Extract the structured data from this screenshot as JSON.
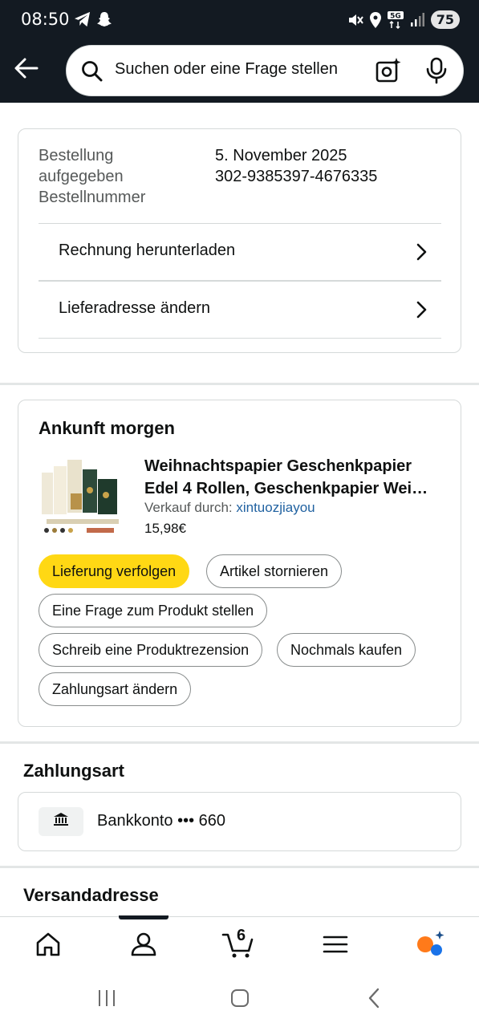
{
  "status": {
    "time": "08:50",
    "battery": "75"
  },
  "search": {
    "placeholder": "Suchen oder eine Frage stellen"
  },
  "order": {
    "label_placed": "Bestellung aufgegeben",
    "label_number": "Bestellnummer",
    "date": "5. November 2025",
    "number": "302-9385397-4676335",
    "invoice_link": "Rechnung herunterladen",
    "address_link": "Lieferadresse ändern"
  },
  "shipment": {
    "heading": "Ankunft morgen",
    "product_title": "Weihnachtspapier Geschenkpapier Edel 4 Rollen, Geschenkpapier Wei…",
    "seller_prefix": "Verkauf durch: ",
    "seller_name": "xintuozjiayou",
    "price": "15,98€",
    "actions": {
      "track": "Lieferung verfolgen",
      "cancel": "Artikel stornieren",
      "question": "Eine Frage zum Produkt stellen",
      "review": "Schreib eine Produktrezension",
      "buy_again": "Nochmals kaufen",
      "change_payment": "Zahlungsart ändern"
    }
  },
  "payment": {
    "heading": "Zahlungsart",
    "method": "Bankkonto ••• 660"
  },
  "shipping": {
    "heading": "Versandadresse"
  },
  "nav": {
    "cart_count": "6"
  },
  "colors": {
    "header_bg": "#131a22",
    "primary_button": "#ffd814",
    "link": "#2162a1",
    "accent_orange": "#ff9900"
  },
  "icons": [
    "back-arrow-icon",
    "search-icon",
    "camera-sparkle-icon",
    "microphone-icon",
    "chevron-right-icon",
    "bank-icon",
    "home-icon",
    "account-icon",
    "cart-icon",
    "menu-icon",
    "rufus-icon"
  ]
}
